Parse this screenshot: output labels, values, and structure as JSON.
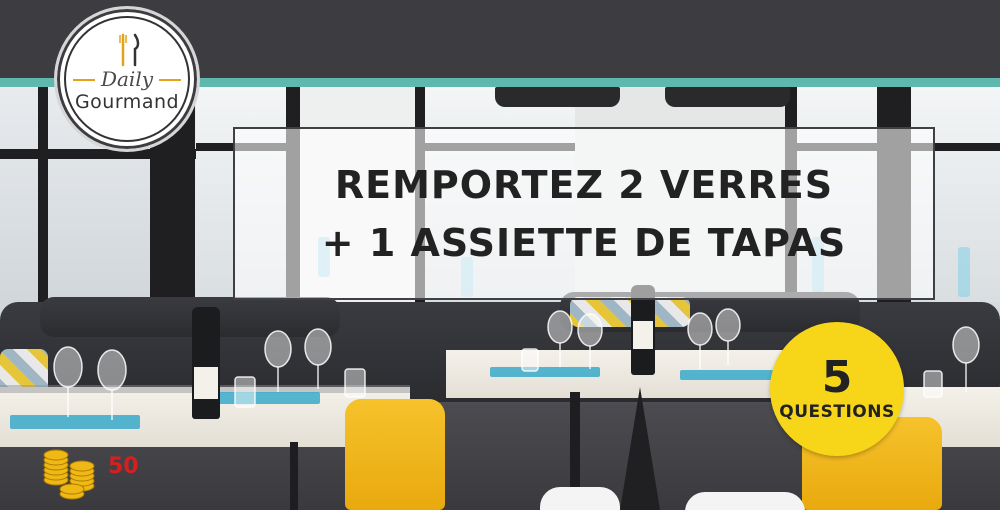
{
  "logo": {
    "line1": "Daily",
    "line2": "Gourmand"
  },
  "headline": {
    "line1": "REMPORTEZ 2 VERRES",
    "line2": "+ 1 ASSIETTE DE TAPAS"
  },
  "questions_badge": {
    "count": "5",
    "label": "QUESTIONS"
  },
  "coins": {
    "value": "50"
  },
  "colors": {
    "topbar": "#3d3c41",
    "accent_teal": "#5fb8ae",
    "badge_yellow": "#f7d61a",
    "coin_red": "#d62020"
  },
  "icons": [
    "utensils-icon",
    "coins-icon"
  ]
}
